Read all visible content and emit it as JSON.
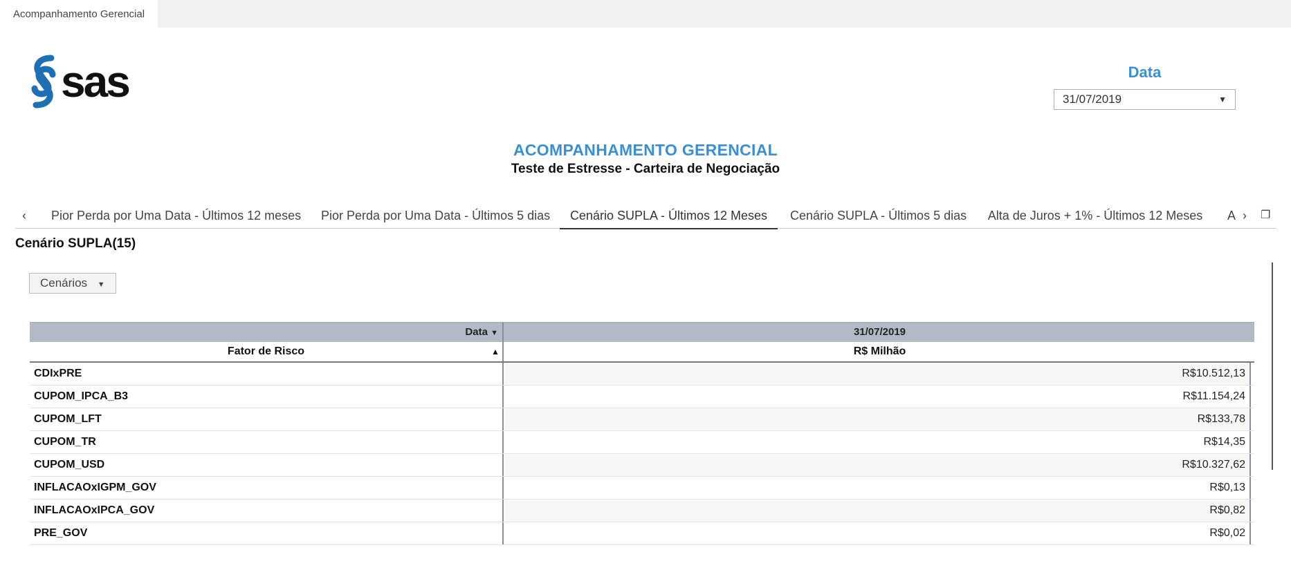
{
  "window": {
    "tab_label": "Acompanhamento Gerencial"
  },
  "brand": {
    "logo_text": "sas"
  },
  "date_prompt": {
    "label": "Data",
    "selected": "31/07/2019"
  },
  "header": {
    "title": "ACOMPANHAMENTO GERENCIAL",
    "subtitle": "Teste de Estresse - Carteira de Negociação"
  },
  "tabs": [
    {
      "label": "Pior Perda por Uma Data - Últimos 12 meses",
      "active": false
    },
    {
      "label": "Pior Perda por Uma Data - Últimos 5 dias",
      "active": false
    },
    {
      "label": "Cenário SUPLA - Últimos 12 Meses",
      "active": true
    },
    {
      "label": "Cenário SUPLA - Últimos 5 dias",
      "active": false
    },
    {
      "label": "Alta de Juros + 1% - Últimos 12 Meses",
      "active": false
    },
    {
      "label": "A",
      "active": false
    }
  ],
  "section": {
    "title": "Cenário SUPLA(15)",
    "filter_button": "Cenários"
  },
  "table": {
    "header_row1": {
      "left": "Data",
      "right": "31/07/2019"
    },
    "header_row2": {
      "left": "Fator de Risco",
      "right": "R$ Milhão"
    },
    "rows": [
      {
        "factor": "CDIxPRE",
        "value": "R$10.512,13"
      },
      {
        "factor": "CUPOM_IPCA_B3",
        "value": "R$11.154,24"
      },
      {
        "factor": "CUPOM_LFT",
        "value": "R$133,78"
      },
      {
        "factor": "CUPOM_TR",
        "value": "R$14,35"
      },
      {
        "factor": "CUPOM_USD",
        "value": "R$10.327,62"
      },
      {
        "factor": "INFLACAOxIGPM_GOV",
        "value": "R$0,13"
      },
      {
        "factor": "INFLACAOxIPCA_GOV",
        "value": "R$0,82"
      },
      {
        "factor": "PRE_GOV",
        "value": "R$0,02"
      }
    ]
  },
  "colors": {
    "accent": "#3a8fd4",
    "logo_blue": "#1f6fb5",
    "header_bg": "#b3bac6"
  }
}
